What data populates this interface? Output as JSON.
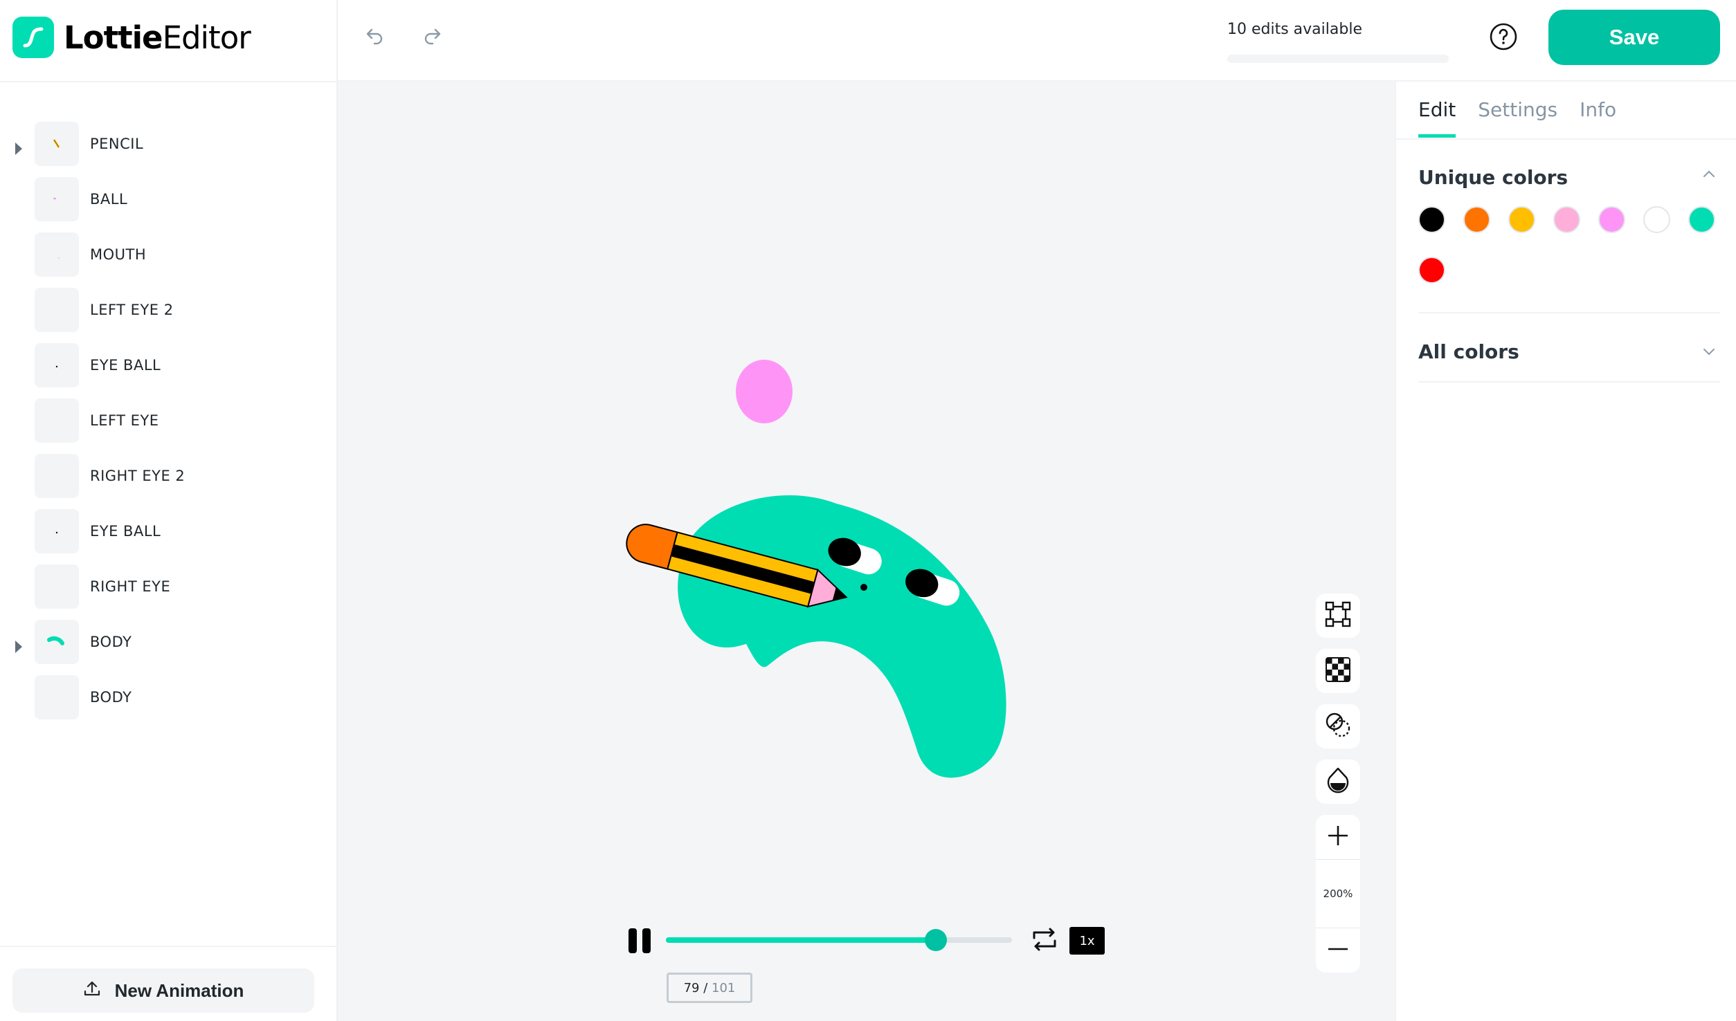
{
  "app": {
    "logo_bold": "Lottie",
    "logo_light": "Editor",
    "brand_color": "#00ddb3"
  },
  "header": {
    "undo_icon": "undo-icon",
    "redo_icon": "redo-icon",
    "edits_label": "10 edits available",
    "edits_progress": 0,
    "help_icon": "question-circle-icon",
    "save_label": "Save"
  },
  "layers": [
    {
      "name": "PENCIL",
      "expandable": true,
      "thumb": "pencil"
    },
    {
      "name": "BALL",
      "expandable": false,
      "thumb": "ball"
    },
    {
      "name": "MOUTH",
      "expandable": false,
      "thumb": "mouth"
    },
    {
      "name": "LEFT EYE 2",
      "expandable": false,
      "thumb": "empty"
    },
    {
      "name": "EYE BALL",
      "expandable": false,
      "thumb": "dot"
    },
    {
      "name": "LEFT EYE",
      "expandable": false,
      "thumb": "empty"
    },
    {
      "name": "RIGHT EYE 2",
      "expandable": false,
      "thumb": "empty"
    },
    {
      "name": "EYE BALL",
      "expandable": false,
      "thumb": "dot"
    },
    {
      "name": "RIGHT EYE",
      "expandable": false,
      "thumb": "empty"
    },
    {
      "name": "BODY",
      "expandable": true,
      "thumb": "body"
    },
    {
      "name": "BODY",
      "expandable": false,
      "thumb": "empty"
    }
  ],
  "sidebar": {
    "new_animation_label": "New Animation",
    "new_animation_icon": "upload-icon"
  },
  "canvas": {
    "tools": [
      "bounding-box-icon",
      "checkerboard-icon",
      "blend-mode-icon",
      "opacity-drop-icon"
    ],
    "zoom_in_icon": "plus-icon",
    "zoom_level": "200%",
    "zoom_out_icon": "minus-icon"
  },
  "player": {
    "current_frame": "79",
    "separator": " / ",
    "total_frames": "101",
    "progress": 0.78,
    "speed_label": "1x",
    "pause_icon": "pause-icon",
    "loop_icon": "loop-icon"
  },
  "panel": {
    "tabs": [
      {
        "label": "Edit",
        "active": true
      },
      {
        "label": "Settings",
        "active": false
      },
      {
        "label": "Info",
        "active": false
      }
    ],
    "unique_colors_title": "Unique colors",
    "unique_colors": [
      "#000000",
      "#ff7300",
      "#ffbe00",
      "#ffadd9",
      "#ff94f7",
      "#ffffff",
      "#00ddb3",
      "#ff0000"
    ],
    "all_colors_title": "All colors"
  }
}
